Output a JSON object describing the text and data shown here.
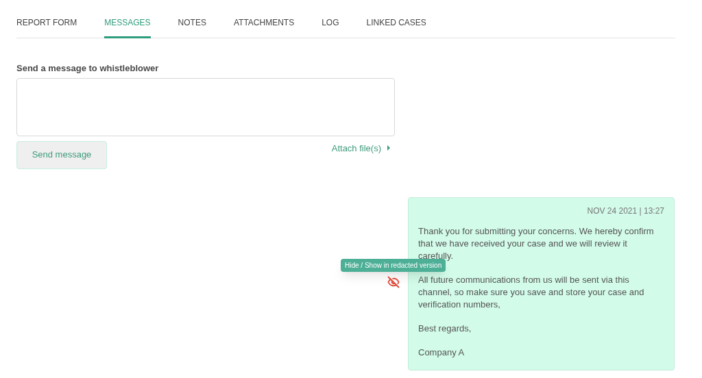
{
  "tabs": [
    {
      "label": "REPORT FORM",
      "selected": false
    },
    {
      "label": "MESSAGES",
      "selected": true
    },
    {
      "label": "NOTES",
      "selected": false
    },
    {
      "label": "ATTACHMENTS",
      "selected": false
    },
    {
      "label": "LOG",
      "selected": false
    },
    {
      "label": "LINKED CASES",
      "selected": false
    }
  ],
  "compose": {
    "label": "Send a message to whistleblower",
    "send_button": "Send message",
    "attach_link": "Attach file(s)"
  },
  "messages": [
    {
      "timestamp": "NOV 24 2021 | 13:27",
      "tooltip": "Hide / Show in redacted version",
      "hidden": true,
      "paragraphs": [
        "Thank you for submitting your concerns. We hereby confirm that we have received your case and we will review it carefully.",
        "All future communications from us will be sent via this channel, so make sure you save and store your case and verification numbers,",
        "Best regards,",
        "Company A"
      ]
    }
  ]
}
